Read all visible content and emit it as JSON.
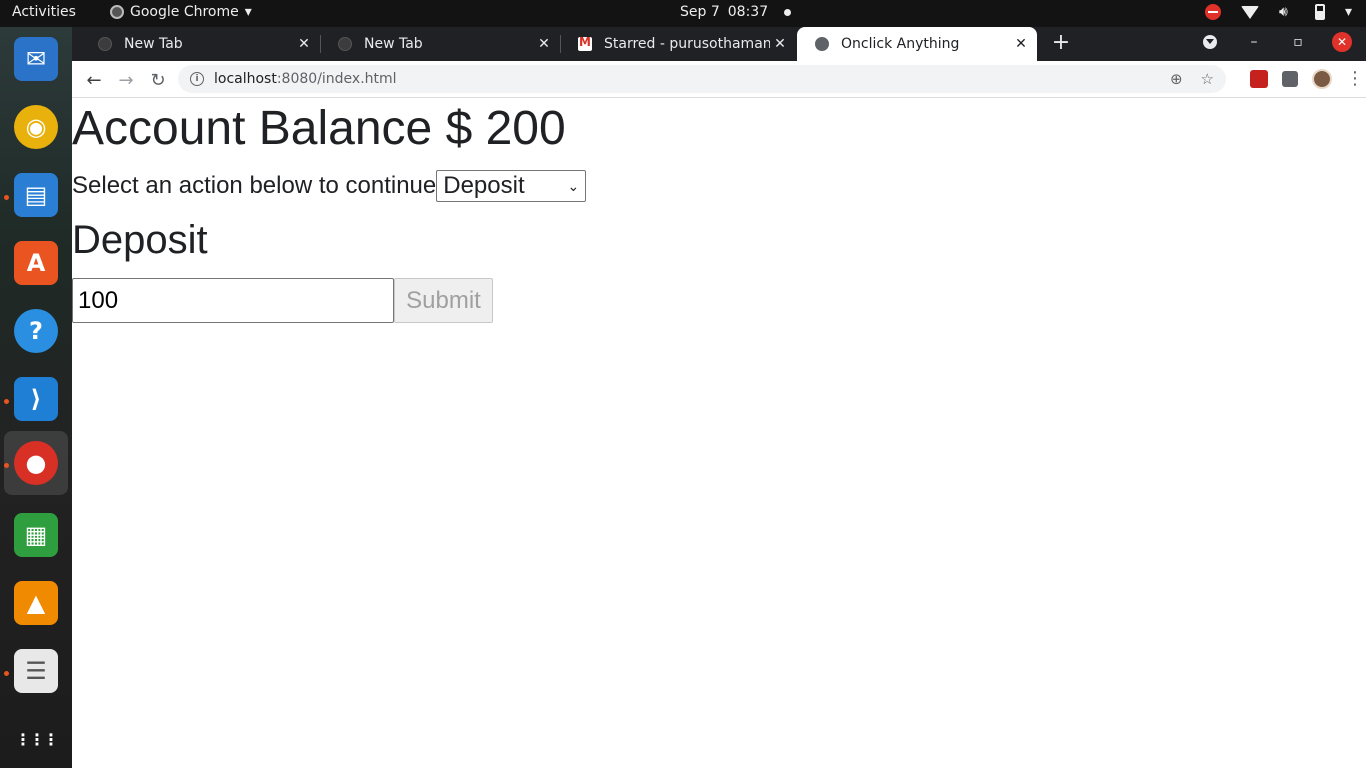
{
  "topbar": {
    "activities": "Activities",
    "app_name": "Google Chrome",
    "date": "Sep 7",
    "time": "08:37"
  },
  "dock": {
    "apps": [
      {
        "name": "thunderbird-icon",
        "color": "#2a73c8",
        "glyph": "✉",
        "running": false
      },
      {
        "name": "rhythmbox-icon",
        "color": "#e8b10c",
        "glyph": "◉",
        "running": false
      },
      {
        "name": "libreoffice-writer-icon",
        "color": "#2a7fd4",
        "glyph": "▤",
        "running": true
      },
      {
        "name": "ubuntu-software-icon",
        "color": "#e95420",
        "glyph": "A",
        "running": false
      },
      {
        "name": "help-icon",
        "color": "#2a8fe0",
        "glyph": "?",
        "running": false
      },
      {
        "name": "vscode-icon",
        "color": "#1f7fd4",
        "glyph": "⟩",
        "running": true
      },
      {
        "name": "chrome-icon",
        "color": "#d93025",
        "glyph": "●",
        "running": true
      },
      {
        "name": "libreoffice-calc-icon",
        "color": "#2e9e3e",
        "glyph": "▦",
        "running": false
      },
      {
        "name": "vlc-icon",
        "color": "#f08a00",
        "glyph": "▲",
        "running": false
      },
      {
        "name": "document-viewer-icon",
        "color": "#e8e8e8",
        "glyph": "☰",
        "running": true
      },
      {
        "name": "show-applications-icon",
        "color": "transparent",
        "glyph": "⋮⋮⋮",
        "running": false
      }
    ]
  },
  "browser": {
    "tabs": [
      {
        "title": "New Tab",
        "active": false,
        "favicon": "chrome-favicon-icon"
      },
      {
        "title": "New Tab",
        "active": false,
        "favicon": "chrome-favicon-icon"
      },
      {
        "title": "Starred - purusothaman@",
        "active": false,
        "favicon": "gmail-favicon-icon"
      },
      {
        "title": "Onclick Anything",
        "active": true,
        "favicon": "globe-favicon-icon"
      }
    ],
    "url_host": "localhost",
    "url_path": ":8080/index.html"
  },
  "page": {
    "balance_heading": "Account Balance $ 200",
    "action_prompt": "Select an action below to continue",
    "action_selected": "Deposit",
    "section_heading": "Deposit",
    "amount_value": "100",
    "submit_label": "Submit"
  }
}
